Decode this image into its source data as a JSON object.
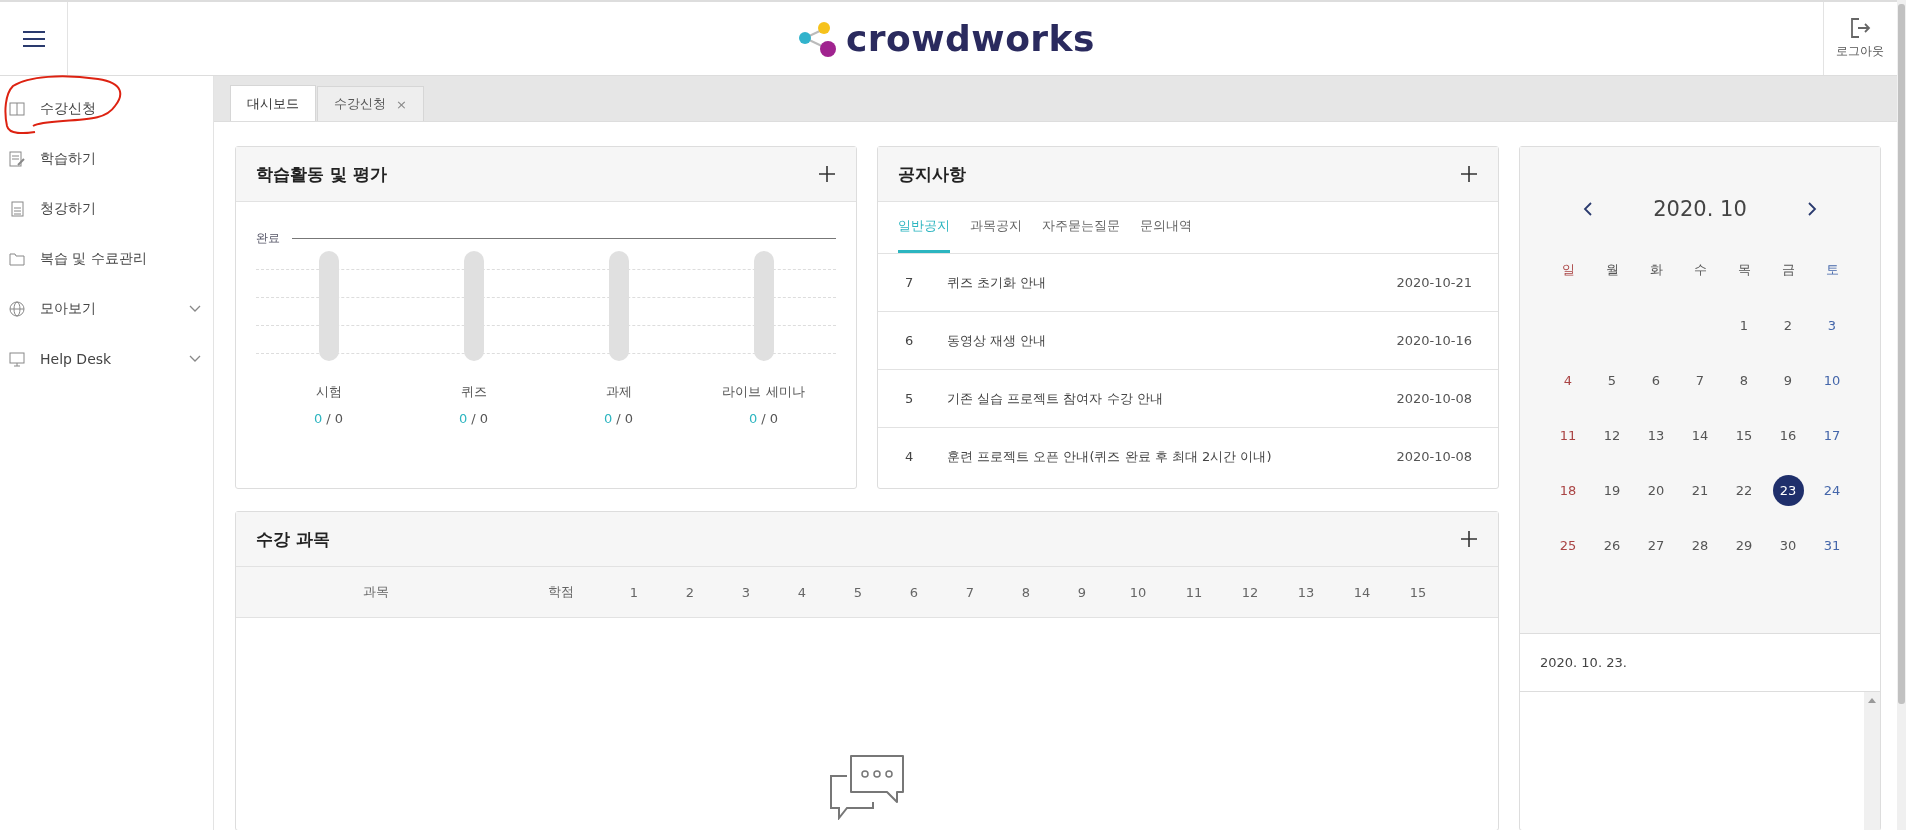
{
  "header": {
    "logo": "crowdworks",
    "logout": "로그아웃"
  },
  "sidebar": {
    "items": [
      {
        "label": "수강신청",
        "kind": "book",
        "expandable": false,
        "circled": true
      },
      {
        "label": "학습하기",
        "kind": "edit",
        "expandable": false,
        "circled": false
      },
      {
        "label": "청강하기",
        "kind": "doc",
        "expandable": false,
        "circled": false
      },
      {
        "label": "복습 및 수료관리",
        "kind": "folder",
        "expandable": false,
        "circled": false
      },
      {
        "label": "모아보기",
        "kind": "globe",
        "expandable": true,
        "circled": false
      },
      {
        "label": "Help Desk",
        "kind": "monitor",
        "expandable": true,
        "circled": false
      }
    ]
  },
  "tabs": [
    {
      "label": "대시보드",
      "selected": true,
      "closable": false
    },
    {
      "label": "수강신청",
      "selected": false,
      "closable": true,
      "close": "×"
    }
  ],
  "activity": {
    "title": "학습활동 및 평가",
    "axis_label": "완료",
    "items": [
      {
        "label": "시험",
        "done": "0",
        "separator": "/",
        "total": "0",
        "level": 0
      },
      {
        "label": "퀴즈",
        "done": "0",
        "separator": "/",
        "total": "0",
        "level": 0
      },
      {
        "label": "과제",
        "done": "0",
        "separator": "/",
        "total": "0",
        "level": 0
      },
      {
        "label": "라이브 세미나",
        "done": "0",
        "separator": "/",
        "total": "0",
        "level": 0
      }
    ]
  },
  "notices": {
    "title": "공지사항",
    "tabs": [
      {
        "label": "일반공지",
        "selected": true
      },
      {
        "label": "과목공지",
        "selected": false
      },
      {
        "label": "자주묻는질문",
        "selected": false
      },
      {
        "label": "문의내역",
        "selected": false
      }
    ],
    "rows": [
      {
        "no": "7",
        "title": "퀴즈 초기화 안내",
        "date": "2020-10-21"
      },
      {
        "no": "6",
        "title": "동영상 재생 안내",
        "date": "2020-10-16"
      },
      {
        "no": "5",
        "title": "기존 실습 프로젝트 참여자 수강 안내",
        "date": "2020-10-08"
      },
      {
        "no": "4",
        "title": "훈련 프로젝트 오픈 안내(퀴즈 완료 후 최대 2시간 이내)",
        "date": "2020-10-08"
      }
    ]
  },
  "calendar": {
    "month": "2020. 10",
    "weekdays": [
      "일",
      "월",
      "화",
      "수",
      "목",
      "금",
      "토"
    ],
    "weeks": [
      [
        {
          "day": "1",
          "selected": false
        },
        {
          "day": "2",
          "selected": false
        },
        {
          "day": "3",
          "selected": false
        }
      ],
      [
        {
          "day": "4",
          "selected": false
        },
        {
          "day": "5",
          "selected": false
        },
        {
          "day": "6",
          "selected": false
        },
        {
          "day": "7",
          "selected": false
        },
        {
          "day": "8",
          "selected": false
        },
        {
          "day": "9",
          "selected": false
        },
        {
          "day": "10",
          "selected": false
        }
      ],
      [
        {
          "day": "11",
          "selected": false
        },
        {
          "day": "12",
          "selected": false
        },
        {
          "day": "13",
          "selected": false
        },
        {
          "day": "14",
          "selected": false
        },
        {
          "day": "15",
          "selected": false
        },
        {
          "day": "16",
          "selected": false
        },
        {
          "day": "17",
          "selected": false
        }
      ],
      [
        {
          "day": "18",
          "selected": false
        },
        {
          "day": "19",
          "selected": false
        },
        {
          "day": "20",
          "selected": false
        },
        {
          "day": "21",
          "selected": false
        },
        {
          "day": "22",
          "selected": false
        },
        {
          "day": "23",
          "selected": true
        },
        {
          "day": "24",
          "selected": false
        }
      ],
      [
        {
          "day": "25",
          "selected": false
        },
        {
          "day": "26",
          "selected": false
        },
        {
          "day": "27",
          "selected": false
        },
        {
          "day": "28",
          "selected": false
        },
        {
          "day": "29",
          "selected": false
        },
        {
          "day": "30",
          "selected": false
        },
        {
          "day": "31",
          "selected": false
        }
      ]
    ],
    "selected_date": "2020. 10. 23."
  },
  "courses": {
    "title": "수강 과목",
    "columns": [
      "과목",
      "학점",
      "1",
      "2",
      "3",
      "4",
      "5",
      "6",
      "7",
      "8",
      "9",
      "10",
      "11",
      "12",
      "13",
      "14",
      "15"
    ]
  }
}
